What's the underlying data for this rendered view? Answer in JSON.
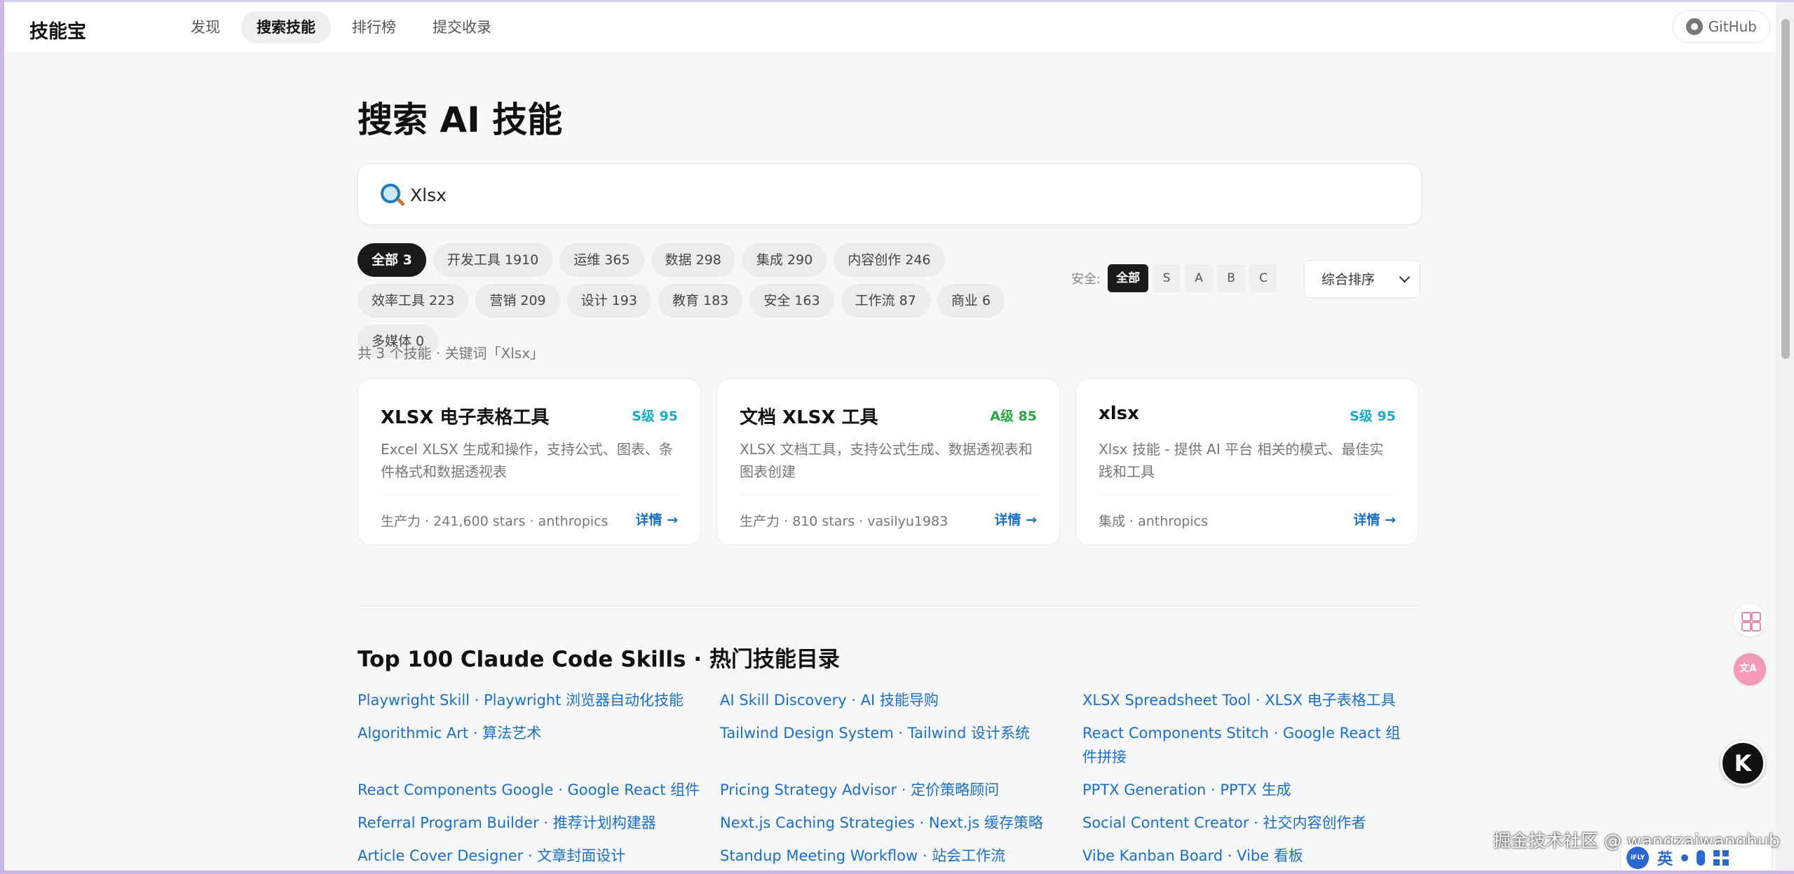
{
  "nav": {
    "brand": "技能宝",
    "links": [
      "发现",
      "搜索技能",
      "排行榜",
      "提交收录"
    ],
    "active_index": 1,
    "github_label": "GitHub"
  },
  "page": {
    "title": "搜索 AI 技能",
    "search_value": "Xlsx"
  },
  "filters": {
    "categories": [
      "全部 3",
      "开发工具 1910",
      "运维 365",
      "数据 298",
      "集成 290",
      "内容创作 246",
      "效率工具 223",
      "营销 209",
      "设计 193",
      "教育 183",
      "安全 163",
      "工作流 87",
      "商业 6",
      "多媒体 0"
    ],
    "active_category_index": 0,
    "safety_label": "安全:",
    "safety_options": [
      "全部",
      "S",
      "A",
      "B",
      "C"
    ],
    "active_safety_index": 0,
    "sort_label": "综合排序"
  },
  "results": {
    "summary": "共 3 个技能 · 关键词「Xlsx」",
    "detail_label": "详情 →",
    "cards": [
      {
        "title": "XLSX 电子表格工具",
        "grade": "S级 95",
        "grade_color": "#1ea9c9",
        "desc": "Excel XLSX 生成和操作，支持公式、图表、条件格式和数据透视表",
        "meta": "生产力 · 241,600 stars · anthropics"
      },
      {
        "title": "文档 XLSX 工具",
        "grade": "A级 85",
        "grade_color": "#28a745",
        "desc": "XLSX 文档工具，支持公式生成、数据透视表和图表创建",
        "meta": "生产力 · 810 stars · vasilyu1983"
      },
      {
        "title": "xlsx",
        "grade": "S级 95",
        "grade_color": "#1ea9c9",
        "desc": "Xlsx 技能 - 提供 AI 平台 相关的模式、最佳实践和工具",
        "meta": "集成 · anthropics"
      }
    ]
  },
  "directory": {
    "title": "Top 100 Claude Code Skills · 热门技能目录",
    "links": [
      "Playwright Skill · Playwright 浏览器自动化技能",
      "AI Skill Discovery · AI 技能导购",
      "XLSX Spreadsheet Tool · XLSX 电子表格工具",
      "Algorithmic Art · 算法艺术",
      "Tailwind Design System · Tailwind 设计系统",
      "React Components Stitch · Google React 组件拼接",
      "React Components Google · Google React 组件",
      "Pricing Strategy Advisor · 定价策略顾问",
      "PPTX Generation · PPTX 生成",
      "Referral Program Builder · 推荐计划构建器",
      "Next.js Caching Strategies · Next.js 缓存策略",
      "Social Content Creator · 社交内容创作者",
      "Article Cover Designer · 文章封面设计",
      "Standup Meeting Workflow · 站会工作流",
      "Vibe Kanban Board · Vibe 看板"
    ]
  },
  "overlay": {
    "watermark": "掘金技术社区 @ wangzaiwanghub",
    "avatar_letter": "K",
    "ime_logo": "iFLY",
    "ime_lang": "英"
  },
  "icons": {
    "search": "magnifier-icon",
    "github": "github-icon",
    "sort": "chevron-down-icon"
  }
}
